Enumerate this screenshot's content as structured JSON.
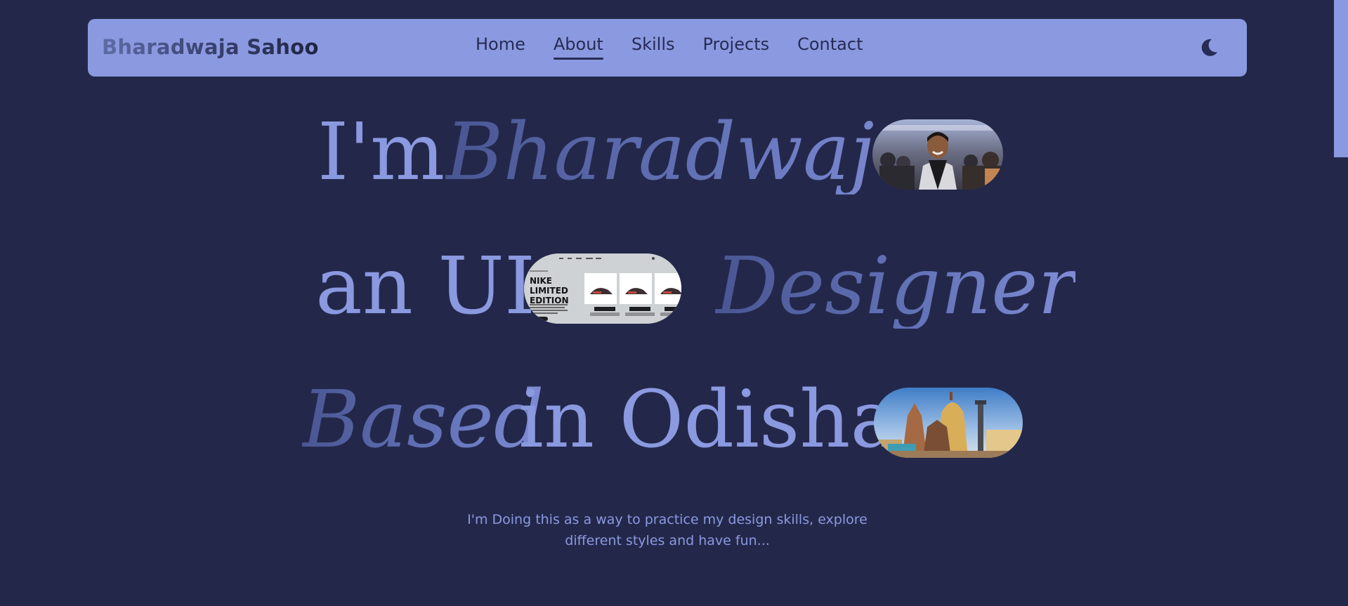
{
  "brand": "Bharadwaja Sahoo",
  "nav": {
    "items": [
      {
        "label": "Home",
        "active": false
      },
      {
        "label": "About",
        "active": true
      },
      {
        "label": "Skills",
        "active": false
      },
      {
        "label": "Projects",
        "active": false
      },
      {
        "label": "Contact",
        "active": false
      }
    ],
    "theme_toggle_icon": "moon-icon"
  },
  "hero": {
    "line1": {
      "plain": "I'm",
      "italic": "Bharadwaja"
    },
    "line2": {
      "plain": "an UI",
      "italic": "Designer"
    },
    "line3": {
      "italic": "Based",
      "plain": "in Odisha"
    },
    "mockup": {
      "headline": [
        "NIKE",
        "LIMITED",
        "EDITION"
      ]
    }
  },
  "subtitle": "I'm Doing this as a way to practice my design skills, explore different styles and have fun...",
  "colors": {
    "background": "#23284a",
    "accent": "#8b99e0",
    "nav_text": "#262c55"
  }
}
